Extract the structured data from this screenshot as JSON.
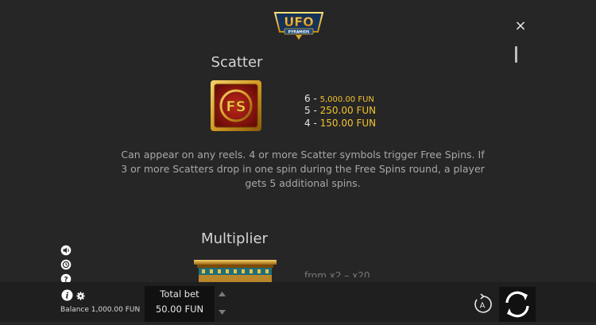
{
  "logo": {
    "title": "UFO",
    "subtitle": "PYRAMIDS"
  },
  "close": {
    "label": "×"
  },
  "scatter": {
    "title": "Scatter",
    "symbol_text": "FS",
    "paytable": [
      {
        "count": "6",
        "separator": "-",
        "amount": "5,000.00 FUN"
      },
      {
        "count": "5",
        "separator": "-",
        "amount": "250.00 FUN"
      },
      {
        "count": "4",
        "separator": "-",
        "amount": "150.00 FUN"
      }
    ],
    "description": "Can appear on any reels. 4 or more Scatter symbols trigger Free Spins. If 3 or more Scatters drop in one spin during the Free Spins round, a player gets 5 additional spins."
  },
  "multiplier": {
    "title": "Multiplier",
    "partial_text": "from x2 – x20"
  },
  "footer": {
    "balance_label": "Balance",
    "balance_value": "1,000.00 FUN",
    "total_bet_label": "Total bet",
    "total_bet_value": "50.00 FUN",
    "autoplay_label": "A"
  },
  "colors": {
    "background": "#262626",
    "accent": "#f2c230",
    "bottom_bar": "#1f1f1f"
  }
}
